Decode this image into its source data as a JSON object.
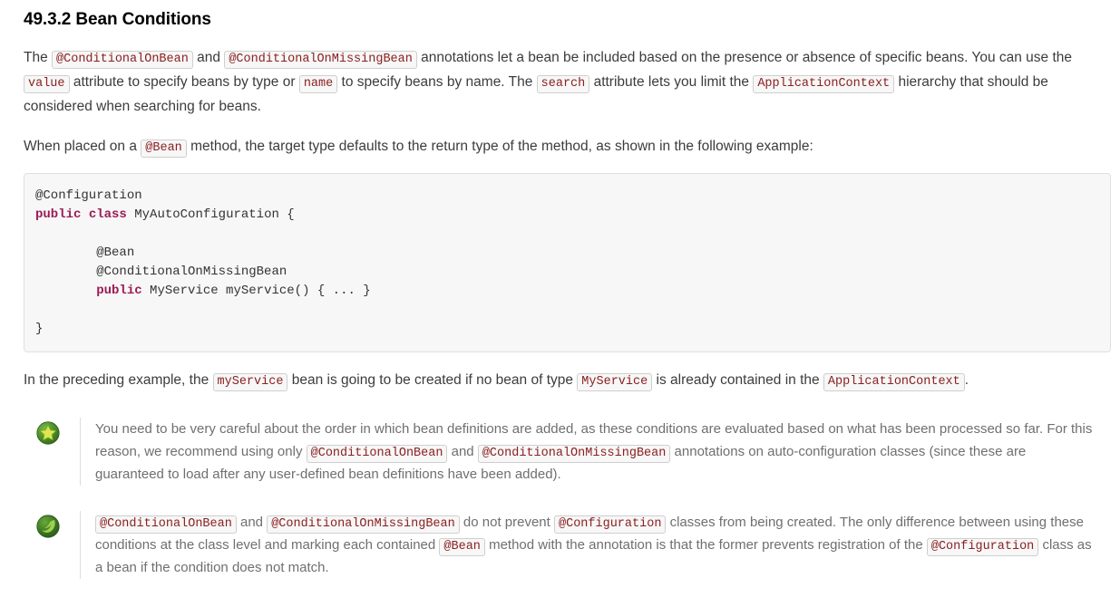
{
  "document": {
    "heading": "49.3.2 Bean Conditions",
    "paragraph1": {
      "part1": "The ",
      "code1": "@ConditionalOnBean",
      "part2": " and ",
      "code2": "@ConditionalOnMissingBean",
      "part3": " annotations let a bean be included based on the presence or absence of specific beans. You can use the ",
      "code3": "value",
      "part4": " attribute to specify beans by type or ",
      "code4": "name",
      "part5": " to specify beans by name. The ",
      "code5": "search",
      "part6": " attribute lets you limit the ",
      "code6": "ApplicationContext",
      "part7": " hierarchy that should be considered when searching for beans."
    },
    "paragraph2": {
      "part1": "When placed on a ",
      "code1": "@Bean",
      "part2": " method, the target type defaults to the return type of the method, as shown in the following example:"
    },
    "code_block": {
      "language": "java",
      "lines": [
        "@Configuration",
        "public class MyAutoConfiguration {",
        "",
        "        @Bean",
        "        @ConditionalOnMissingBean",
        "        public MyService myService() { ... }",
        "",
        "}"
      ],
      "keywords": [
        "public",
        "class"
      ],
      "line1": "@Configuration",
      "line2_kw1": "public",
      "line2_kw2": "class",
      "line2_rest": "MyAutoConfiguration {",
      "line4": "@Bean",
      "line5": "@ConditionalOnMissingBean",
      "line6_kw": "public",
      "line6_rest": "MyService myService() { ... }",
      "line8": "}"
    },
    "paragraph3": {
      "part1": "In the preceding example, the ",
      "code1": "myService",
      "part2": " bean is going to be created if no bean of type ",
      "code2": "MyService",
      "part3": " is already contained in the ",
      "code3": "ApplicationContext",
      "part4": "."
    },
    "admonitions": [
      {
        "icon": "tip-star-icon",
        "type": "tip",
        "icon_colors": {
          "circle": "#4a8b2c",
          "shape": "#d6e34f"
        },
        "part1": "You need to be very careful about the order in which bean definitions are added, as these conditions are evaluated based on what has been processed so far. For this reason, we recommend using only ",
        "code1": "@ConditionalOnBean",
        "part2": " and ",
        "code2": "@ConditionalOnMissingBean",
        "part3": " annotations on auto-configuration classes (since these are guaranteed to load after any user-defined bean definitions have been added)."
      },
      {
        "icon": "spring-leaf-icon",
        "type": "note",
        "icon_colors": {
          "circle": "#3f7a23",
          "shape": "#8fc63d"
        },
        "part1": "",
        "code1": "@ConditionalOnBean",
        "part2": " and ",
        "code2": "@ConditionalOnMissingBean",
        "part3": " do not prevent ",
        "code3": "@Configuration",
        "part4": " classes from being created. The only difference between using these conditions at the class level and marking each contained ",
        "code4": "@Bean",
        "part5": " method with the annotation is that the former prevents registration of the ",
        "code5": "@Configuration",
        "part6": " class as a bean if the condition does not match."
      }
    ]
  },
  "colors": {
    "body_text": "#3c3c3c",
    "note_text": "#6f6f6f",
    "inline_code_text": "#8b2020",
    "inline_code_bg": "#f7f7f7",
    "code_block_bg": "#f7f7f7",
    "keyword": "#9b1b56",
    "page_bg": "#ffffff"
  }
}
